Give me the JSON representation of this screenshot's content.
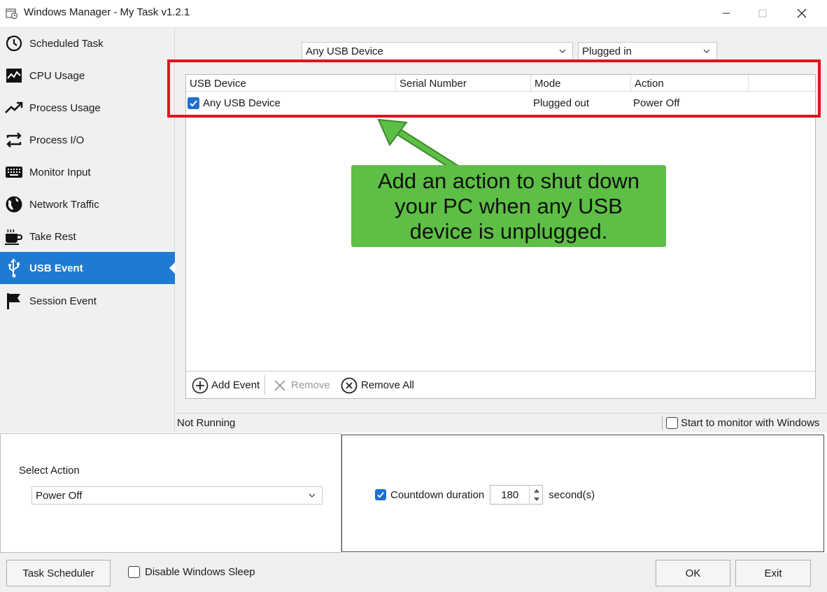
{
  "window": {
    "title": "Windows Manager - My Task v1.2.1",
    "icons": {
      "app": "task-clock-icon",
      "minimize": "minimize-icon",
      "maximize": "maximize-icon",
      "close": "close-icon"
    }
  },
  "sidebar": {
    "active_index": 7,
    "items": [
      {
        "label": "Scheduled Task",
        "icon": "clock-icon"
      },
      {
        "label": "CPU Usage",
        "icon": "cpu-chart-icon"
      },
      {
        "label": "Process Usage",
        "icon": "trend-up-icon"
      },
      {
        "label": "Process I/O",
        "icon": "swap-arrows-icon"
      },
      {
        "label": "Monitor Input",
        "icon": "keyboard-icon"
      },
      {
        "label": "Network Traffic",
        "icon": "globe-icon"
      },
      {
        "label": "Take Rest",
        "icon": "coffee-cup-icon"
      },
      {
        "label": "USB Event",
        "icon": "usb-icon"
      },
      {
        "label": "Session Event",
        "icon": "flag-icon"
      }
    ]
  },
  "filters": {
    "device": "Any USB Device",
    "mode": "Plugged in"
  },
  "list": {
    "columns": [
      "USB Device",
      "Serial Number",
      "Mode",
      "Action"
    ],
    "rows": [
      {
        "checked": true,
        "device": "Any USB Device",
        "serial": "",
        "mode": "Plugged out",
        "action": "Power Off"
      }
    ]
  },
  "toolbar": {
    "add": "Add Event",
    "remove": "Remove",
    "remove_all": "Remove All"
  },
  "callout": {
    "text": "Add an action to shut down your PC when any USB device is unplugged."
  },
  "status": {
    "text": "Not Running",
    "start_with_windows": "Start to monitor with Windows",
    "start_with_windows_checked": false
  },
  "action": {
    "label": "Select Action",
    "value": "Power Off"
  },
  "countdown": {
    "checked": true,
    "label": "Countdown duration",
    "value": "180",
    "unit": "second(s)"
  },
  "footer": {
    "task_scheduler": "Task Scheduler",
    "disable_sleep": "Disable Windows Sleep",
    "disable_sleep_checked": false,
    "ok": "OK",
    "exit": "Exit"
  },
  "colors": {
    "accent": "#1f7ad2",
    "highlight": "#e0141e",
    "callout": "#5dbf45"
  }
}
